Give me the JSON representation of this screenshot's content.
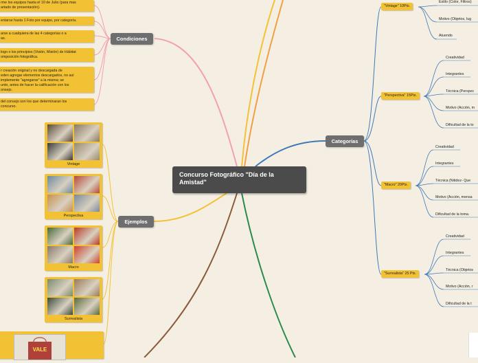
{
  "root": {
    "title": "Concurso Fotográfico \"Día de la Amistad\""
  },
  "branches": {
    "condiciones": "Condiciones",
    "ejemplos": "Ejemplos",
    "categorias": "Categorías"
  },
  "condiciones_items": [
    "rme los equipos hasta el 10 de Julio (para mas",
    "artado de presentación).",
    "entarse hasta 1 Foto por equipo, por categoría.",
    "arse a cualquiera de las 4 categorías o a",
    "as.",
    "logo o los principios (Visión, Misión) de Hábitat",
    "omposición fotográfica.",
    "r creación original y no descargada de",
    "eden agregar elementos descargados, no así",
    "implemente \"agregarse\" a la misma; se",
    "unto, antes de hacer la calificación con los",
    "onsejo.",
    "del consejo son los que determinaran los",
    "concurso."
  ],
  "ejemplos": [
    {
      "caption": "Vintage",
      "colors": [
        "#5a4a3a",
        "#8a7a62",
        "#3a3a3a",
        "#9a8a70"
      ]
    },
    {
      "caption": "Perspectiva",
      "colors": [
        "#6a8aa0",
        "#b84a3a",
        "#c89050",
        "#7a8a9a"
      ]
    },
    {
      "caption": "Macro",
      "colors": [
        "#4a6a3a",
        "#b83a2a",
        "#8a7a6a",
        "#d04030"
      ]
    },
    {
      "caption": "Surrealista",
      "colors": [
        "#7a8a6a",
        "#9a7a5a",
        "#3a4a3a",
        "#5a6a3a"
      ]
    }
  ],
  "bag_text": "VALE",
  "categorias": [
    {
      "label": "\"Vintage\" 10Pts.",
      "items": [
        "Estilo (Color, Filtros)",
        "Motivo (Objetos, lug",
        "Atuendo"
      ]
    },
    {
      "label": "\"Perspectiva\" 15Pts.",
      "items": [
        "Creatividad",
        "Integrantes",
        "Técnica (Perspec",
        "Motivo (Acción, m",
        "Dificultad de la to"
      ]
    },
    {
      "label": "\"Macro\" 20Pts.",
      "items": [
        "Creatividad",
        "Integrantes",
        "Técnica (Nitidez- Que",
        "Motivo (Acción, mensa",
        "Dificultad de la toma."
      ]
    },
    {
      "label": "\"Surrealista\" 25 Pts.",
      "items": [
        "Creatividad",
        "Integrantes",
        "Técnica (Objetos",
        "Motivo (Acción, r",
        "Dificultad de la t"
      ]
    }
  ]
}
